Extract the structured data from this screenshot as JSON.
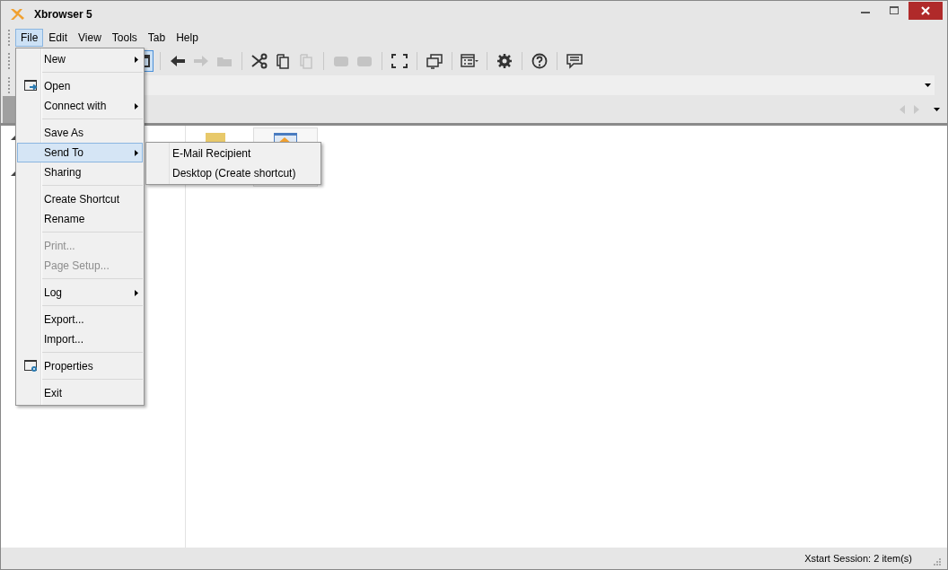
{
  "window": {
    "title": "Xbrowser 5"
  },
  "menubar": [
    {
      "label": "File",
      "selected": true
    },
    {
      "label": "Edit",
      "selected": false
    },
    {
      "label": "View",
      "selected": false
    },
    {
      "label": "Tools",
      "selected": false
    },
    {
      "label": "Tab",
      "selected": false
    },
    {
      "label": "Help",
      "selected": false
    }
  ],
  "toolbar": [
    [
      {
        "disabled": false
      }
    ],
    [
      {
        "disabled": false
      },
      {
        "disabled": true
      },
      {
        "disabled": true
      }
    ],
    [
      {
        "disabled": false
      },
      {
        "disabled": false
      },
      {
        "disabled": true
      }
    ],
    [
      {
        "disabled": true
      },
      {
        "disabled": true
      }
    ],
    [
      {
        "disabled": false
      }
    ],
    [
      {
        "disabled": false
      }
    ],
    [
      {
        "disabled": false
      }
    ],
    [
      {
        "disabled": false
      }
    ],
    [
      {
        "disabled": false
      }
    ],
    [
      {
        "disabled": false
      }
    ]
  ],
  "file_menu": [
    [
      {
        "label": "New",
        "submenu": true,
        "disabled": false,
        "selected": false
      }
    ],
    [
      {
        "label": "Open",
        "submenu": false,
        "disabled": false,
        "selected": false
      },
      {
        "label": "Connect with",
        "submenu": true,
        "disabled": false,
        "selected": false
      }
    ],
    [
      {
        "label": "Save As",
        "submenu": false,
        "disabled": false,
        "selected": false
      },
      {
        "label": "Send To",
        "submenu": true,
        "disabled": false,
        "selected": true
      },
      {
        "label": "Sharing",
        "submenu": false,
        "disabled": false,
        "selected": false
      }
    ],
    [
      {
        "label": "Create Shortcut",
        "submenu": false,
        "disabled": false,
        "selected": false
      },
      {
        "label": "Rename",
        "submenu": false,
        "disabled": false,
        "selected": false
      }
    ],
    [
      {
        "label": "Print...",
        "submenu": false,
        "disabled": true,
        "selected": false
      },
      {
        "label": "Page Setup...",
        "submenu": false,
        "disabled": true,
        "selected": false
      }
    ],
    [
      {
        "label": "Log",
        "submenu": true,
        "disabled": false,
        "selected": false
      }
    ],
    [
      {
        "label": "Export...",
        "submenu": false,
        "disabled": false,
        "selected": false
      },
      {
        "label": "Import...",
        "submenu": false,
        "disabled": false,
        "selected": false
      }
    ],
    [
      {
        "label": "Properties",
        "submenu": false,
        "disabled": false,
        "selected": false
      }
    ],
    [
      {
        "label": "Exit",
        "submenu": false,
        "disabled": false,
        "selected": false
      }
    ]
  ],
  "send_to_submenu": [
    {
      "label": "E-Mail Recipient"
    },
    {
      "label": "Desktop (Create shortcut)"
    }
  ],
  "status_bar": {
    "text": "Xstart Session:  2 item(s)"
  }
}
